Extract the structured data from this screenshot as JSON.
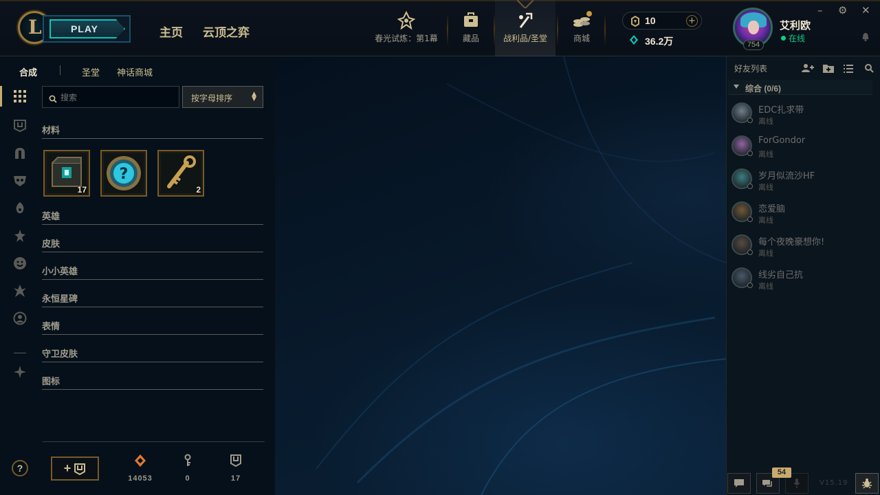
{
  "header": {
    "play_label": "PLAY",
    "nav": [
      {
        "label": "主页"
      },
      {
        "label": "云顶之弈"
      }
    ],
    "icons": [
      {
        "icon": "spring-trial-icon",
        "label": "春光试炼：第1幕"
      },
      {
        "icon": "collection-icon",
        "label": "藏品"
      },
      {
        "icon": "loot-icon",
        "label": "战利品/圣堂"
      },
      {
        "icon": "store-icon",
        "label": "商城"
      }
    ],
    "rp": "10",
    "blue_essence": "36.2万",
    "profile": {
      "name": "艾利欧",
      "status": "在线",
      "level": "754"
    },
    "window_controls": [
      "–",
      "⚙",
      "✕"
    ]
  },
  "left": {
    "subtabs": [
      {
        "label": "合成"
      },
      {
        "label": "圣堂"
      },
      {
        "label": "神话商城"
      }
    ],
    "search_placeholder": "搜索",
    "sort_label": "按字母排序",
    "categories": [
      "材料",
      "英雄",
      "皮肤",
      "小小英雄",
      "永恒星碑",
      "表情",
      "守卫皮肤",
      "图标"
    ],
    "materials": [
      {
        "icon": "chest-icon",
        "count": "17"
      },
      {
        "icon": "mystery-icon",
        "count": ""
      },
      {
        "icon": "key-icon",
        "count": "2"
      }
    ],
    "stats": [
      {
        "icon": "orange-essence-icon",
        "value": "14053"
      },
      {
        "icon": "key-fragment-icon",
        "value": "0"
      },
      {
        "icon": "chest-icon",
        "value": "17"
      }
    ],
    "help_label": "?",
    "craft_label": "+"
  },
  "friends": {
    "title": "好友列表",
    "group": "综合 (0/6)",
    "list": [
      {
        "name": "EDC扎求带",
        "status": "离线",
        "color": "#8a9aa8"
      },
      {
        "name": "ForGondor",
        "status": "离线",
        "color": "#b07ac0"
      },
      {
        "name": "岁月似流沙HF",
        "status": "离线",
        "color": "#4a9a9a"
      },
      {
        "name": "恋爱脑",
        "status": "离线",
        "color": "#8a6a40"
      },
      {
        "name": "每个夜晚豪想你!",
        "status": "离线",
        "color": "#6a5a4a"
      },
      {
        "name": "线劣自己抗",
        "status": "离线",
        "color": "#5a6a7a"
      }
    ],
    "chat_badge": "54",
    "version": "V15.19"
  },
  "colors": {
    "gold": "#c8aa6e",
    "teal": "#0ac8b9",
    "online": "#0acf83",
    "bg": "#010a13"
  }
}
